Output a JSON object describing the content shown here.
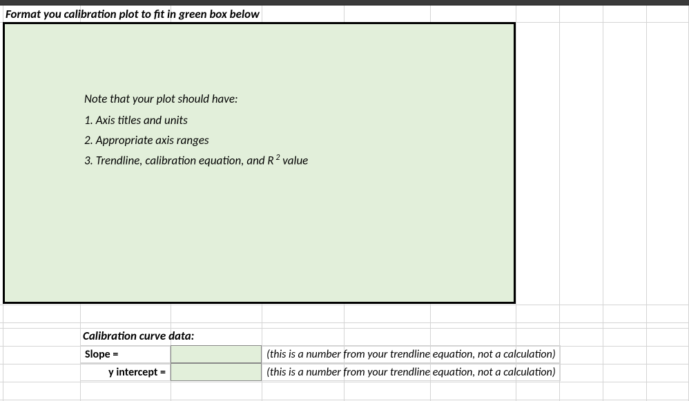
{
  "header": {
    "instruction": "Format you calibration plot to fit in green box below"
  },
  "note": {
    "title": "Note that your plot should have:",
    "item1": "1.  Axis titles and units",
    "item2": "2.  Appropriate axis ranges",
    "item3_pre": "3.  Trendline, calibration equation, and R",
    "item3_sup": " 2",
    "item3_post": "  value"
  },
  "data_section": {
    "header": "Calibration curve data:",
    "slope_label": "Slope =",
    "slope_value": "",
    "slope_hint": "(this is a number from your trendline equation, not a calculation)",
    "yint_label": "y intercept =",
    "yint_value": "",
    "yint_hint": "(this is a number from your trendline equation, not a calculation)"
  }
}
